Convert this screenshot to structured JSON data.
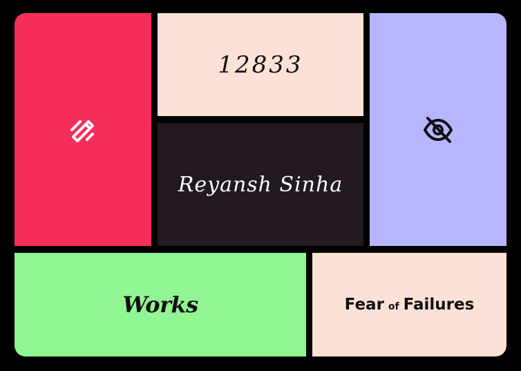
{
  "colors": {
    "background": "#000000",
    "edit_tile": "#f72d5a",
    "number_tile": "#fbe1d6",
    "name_tile": "#221a20",
    "hidden_tile": "#b8b5ff",
    "works_tile": "#92f594",
    "fear_tile": "#fbe1d6"
  },
  "tiles": {
    "edit": {
      "icon": "edit-pencil-icon"
    },
    "number": {
      "value": "12833"
    },
    "name": {
      "value": "Reyansh Sinha"
    },
    "hidden": {
      "icon": "eye-slash-icon"
    },
    "works": {
      "label": "Works"
    },
    "fear": {
      "word1": "Fear",
      "word2": "of",
      "word3": "Failures"
    }
  }
}
